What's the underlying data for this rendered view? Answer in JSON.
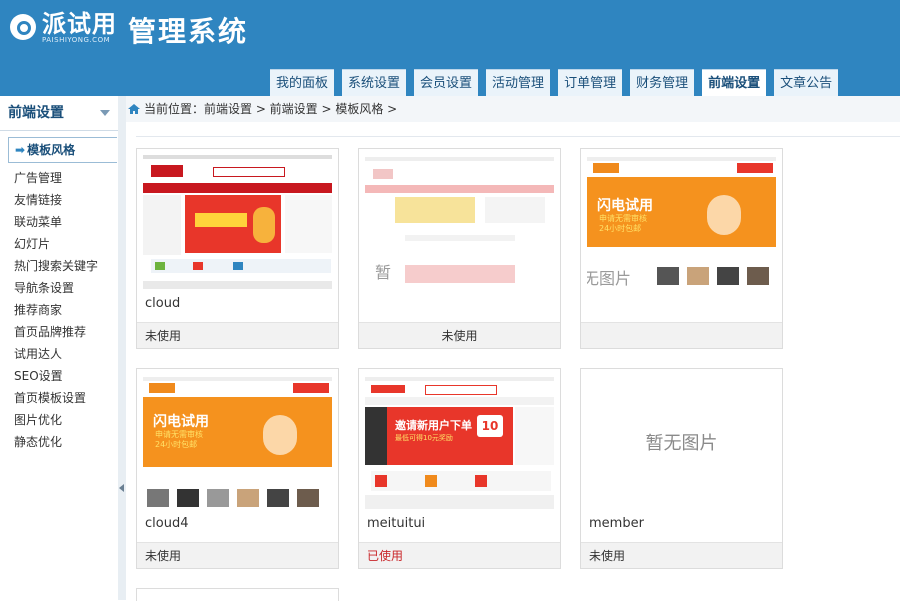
{
  "header": {
    "logo_cn": "派试用",
    "logo_en": "PAISHIYONG.COM",
    "title": "管理系统"
  },
  "nav": {
    "tabs": [
      {
        "label": "我的面板",
        "active": false
      },
      {
        "label": "系统设置",
        "active": false
      },
      {
        "label": "会员设置",
        "active": false
      },
      {
        "label": "活动管理",
        "active": false
      },
      {
        "label": "订单管理",
        "active": false
      },
      {
        "label": "财务管理",
        "active": false
      },
      {
        "label": "前端设置",
        "active": true
      },
      {
        "label": "文章公告",
        "active": false
      }
    ]
  },
  "sidebar": {
    "title": "前端设置",
    "items": [
      {
        "label": "模板风格",
        "active": true
      },
      {
        "label": "广告管理"
      },
      {
        "label": "友情链接"
      },
      {
        "label": "联动菜单"
      },
      {
        "label": "幻灯片"
      },
      {
        "label": "热门搜索关键字"
      },
      {
        "label": "导航条设置"
      },
      {
        "label": "推荐商家"
      },
      {
        "label": "首页品牌推荐"
      },
      {
        "label": "试用达人"
      },
      {
        "label": "SEO设置"
      },
      {
        "label": "首页模板设置"
      },
      {
        "label": "图片优化"
      },
      {
        "label": "静态优化"
      }
    ]
  },
  "breadcrumb": {
    "text": "当前位置：前端设置 > 前端设置 > 模板风格 >"
  },
  "templates": [
    {
      "name": "cloud",
      "status": "未使用",
      "used": false,
      "thumb": "red-site"
    },
    {
      "name": "",
      "status": "未使用",
      "used": false,
      "thumb": "ghost-site",
      "ghost_text": "暂"
    },
    {
      "name": "",
      "status": "",
      "used": false,
      "thumb": "orange-site",
      "ghost_text": "暂无图片"
    },
    {
      "name": "cloud4",
      "status": "未使用",
      "used": false,
      "thumb": "orange-site"
    },
    {
      "name": "meituitui",
      "status": "已使用",
      "used": true,
      "thumb": "meituitui-site"
    },
    {
      "name": "member",
      "status": "未使用",
      "used": false,
      "thumb": "none"
    }
  ],
  "labels": {
    "no_image": "暂无图片"
  },
  "thumb_text": {
    "flash_trial": "闪电试用",
    "flash_sub": "申请无需审核",
    "flash_sub2": "24小时包邮",
    "invite": "邀请新用户下单",
    "invite_sub": "最低可得10元奖励",
    "ten": "10"
  },
  "colors": {
    "header": "#2f85c0",
    "used": "#c9262a",
    "orange": "#f08a1c",
    "red": "#d8232a"
  }
}
